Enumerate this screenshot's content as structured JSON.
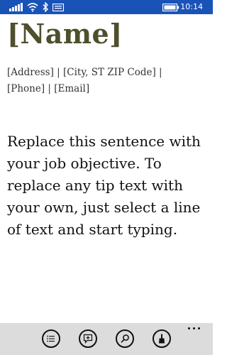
{
  "status_bar": {
    "time": "10:14",
    "icons": [
      "signal-icon",
      "wifi-icon",
      "bluetooth-icon",
      "message-icon",
      "battery-icon"
    ]
  },
  "document": {
    "name": "[Name]",
    "contact": "[Address] | [City, ST ZIP Code] | [Phone] | [Email]",
    "objective": "Replace this sentence with your job objective. To replace any tip text with your own, just select a line of text and start typing."
  },
  "app_bar": {
    "buttons": [
      "outline-icon",
      "comment-icon",
      "search-icon",
      "format-brush-icon"
    ],
    "more": "more-options-icon"
  },
  "colors": {
    "status_bar": "#1a53b8",
    "name_text": "#4f4f2d",
    "app_bar": "#dcdcdc"
  }
}
